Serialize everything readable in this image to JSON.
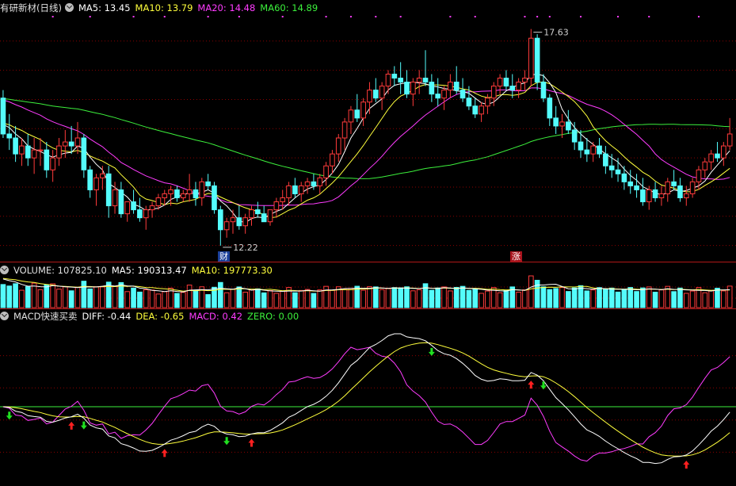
{
  "price_panel": {
    "title": "有研新材(日线)",
    "ma5_label": "MA5: 13.45",
    "ma10_label": "MA10: 13.79",
    "ma20_label": "MA20: 14.48",
    "ma60_label": "MA60: 14.89",
    "high_label": "17.63",
    "low_label": "12.22",
    "badge_cai": "财",
    "badge_zhang": "涨"
  },
  "volume_panel": {
    "volume_label": "VOLUME: 107825.10",
    "ma5_label": "MA5: 190313.47",
    "ma10_label": "MA10: 197773.30"
  },
  "macd_panel": {
    "title": "MACD快速买卖",
    "diff_label": "DIFF: -0.44",
    "dea_label": "DEA: -0.65",
    "macd_label": "MACD: 0.42",
    "zero_label": "ZERO: 0.00"
  },
  "colors": {
    "up": "#ff3b3b",
    "down": "#54fcfc",
    "ma5": "#ffffff",
    "ma10": "#ffff3c",
    "ma20": "#ff3cff",
    "ma60": "#3cf03c",
    "grid": "#8b0000",
    "separator": "#b01818"
  },
  "chart_data": {
    "type": "candlestick",
    "title": "有研新材(日线)",
    "ylim": [
      11.9,
      18.0
    ],
    "candles": [
      [
        15.9,
        16.1,
        14.9,
        15.0
      ],
      [
        15.0,
        15.5,
        14.6,
        14.9
      ],
      [
        14.9,
        15.2,
        14.3,
        14.5
      ],
      [
        14.5,
        14.9,
        14.2,
        14.7
      ],
      [
        14.7,
        15.0,
        14.2,
        14.4
      ],
      [
        14.4,
        14.9,
        14.0,
        14.6
      ],
      [
        14.6,
        14.9,
        14.2,
        14.6
      ],
      [
        14.6,
        14.8,
        13.9,
        14.1
      ],
      [
        14.1,
        14.6,
        13.8,
        14.4
      ],
      [
        14.4,
        14.9,
        14.2,
        14.7
      ],
      [
        14.7,
        15.1,
        14.4,
        14.8
      ],
      [
        14.8,
        15.2,
        14.5,
        14.7
      ],
      [
        14.7,
        15.3,
        14.5,
        14.9
      ],
      [
        14.9,
        15.0,
        13.9,
        14.1
      ],
      [
        14.1,
        14.2,
        13.4,
        13.6
      ],
      [
        13.6,
        14.0,
        13.2,
        13.9
      ],
      [
        13.9,
        14.2,
        13.6,
        14.0
      ],
      [
        14.0,
        14.2,
        12.9,
        13.2
      ],
      [
        13.2,
        13.8,
        13.0,
        13.6
      ],
      [
        13.6,
        13.8,
        12.9,
        13.0
      ],
      [
        13.0,
        13.3,
        12.8,
        13.3
      ],
      [
        13.3,
        13.6,
        13.0,
        13.1
      ],
      [
        13.1,
        13.4,
        12.8,
        12.9
      ],
      [
        12.9,
        13.2,
        12.6,
        13.1
      ],
      [
        13.1,
        13.3,
        12.9,
        13.2
      ],
      [
        13.2,
        13.5,
        13.1,
        13.4
      ],
      [
        13.4,
        13.6,
        13.2,
        13.5
      ],
      [
        13.5,
        13.7,
        13.2,
        13.6
      ],
      [
        13.6,
        13.7,
        13.3,
        13.4
      ],
      [
        13.4,
        13.6,
        13.3,
        13.5
      ],
      [
        13.5,
        14.0,
        13.3,
        13.6
      ],
      [
        13.6,
        13.8,
        13.2,
        13.4
      ],
      [
        13.4,
        13.9,
        13.2,
        13.8
      ],
      [
        13.8,
        14.0,
        13.6,
        13.7
      ],
      [
        13.7,
        13.8,
        13.0,
        13.1
      ],
      [
        13.1,
        13.2,
        12.2,
        12.6
      ],
      [
        12.6,
        12.9,
        12.4,
        12.8
      ],
      [
        12.8,
        13.1,
        12.5,
        12.9
      ],
      [
        12.9,
        13.2,
        12.6,
        12.7
      ],
      [
        12.7,
        13.0,
        12.5,
        12.9
      ],
      [
        12.9,
        13.2,
        12.7,
        13.1
      ],
      [
        13.1,
        13.3,
        12.9,
        13.0
      ],
      [
        13.0,
        13.2,
        12.8,
        12.8
      ],
      [
        12.8,
        13.1,
        12.7,
        13.1
      ],
      [
        13.1,
        13.4,
        12.9,
        13.3
      ],
      [
        13.3,
        13.6,
        13.1,
        13.4
      ],
      [
        13.4,
        13.8,
        13.2,
        13.7
      ],
      [
        13.7,
        13.9,
        13.4,
        13.5
      ],
      [
        13.5,
        13.8,
        13.3,
        13.7
      ],
      [
        13.7,
        13.9,
        13.5,
        13.8
      ],
      [
        13.8,
        14.0,
        13.6,
        13.7
      ],
      [
        13.7,
        14.0,
        13.5,
        13.9
      ],
      [
        13.9,
        14.3,
        13.7,
        14.2
      ],
      [
        14.2,
        14.6,
        14.0,
        14.5
      ],
      [
        14.5,
        15.0,
        14.3,
        14.9
      ],
      [
        14.9,
        15.4,
        14.6,
        15.3
      ],
      [
        15.3,
        15.7,
        15.0,
        15.6
      ],
      [
        15.6,
        16.0,
        15.3,
        15.4
      ],
      [
        15.4,
        15.9,
        15.2,
        15.8
      ],
      [
        15.8,
        16.3,
        15.5,
        16.1
      ],
      [
        16.1,
        16.4,
        15.8,
        15.9
      ],
      [
        15.9,
        16.3,
        15.6,
        16.2
      ],
      [
        16.2,
        16.6,
        16.0,
        16.5
      ],
      [
        16.5,
        16.7,
        16.2,
        16.4
      ],
      [
        16.4,
        16.8,
        16.0,
        16.3
      ],
      [
        16.3,
        16.6,
        15.9,
        16.0
      ],
      [
        16.0,
        16.4,
        15.7,
        16.3
      ],
      [
        16.3,
        16.6,
        16.0,
        16.4
      ],
      [
        16.4,
        17.1,
        16.2,
        16.3
      ],
      [
        16.3,
        16.5,
        15.8,
        16.0
      ],
      [
        16.0,
        16.4,
        15.7,
        15.9
      ],
      [
        15.9,
        16.2,
        15.6,
        16.1
      ],
      [
        16.1,
        16.5,
        15.9,
        16.3
      ],
      [
        16.3,
        16.7,
        16.0,
        16.1
      ],
      [
        16.1,
        16.4,
        15.8,
        15.9
      ],
      [
        15.9,
        16.2,
        15.6,
        15.7
      ],
      [
        15.7,
        15.9,
        15.4,
        15.5
      ],
      [
        15.5,
        15.8,
        15.3,
        15.7
      ],
      [
        15.7,
        16.0,
        15.5,
        15.9
      ],
      [
        15.9,
        16.3,
        15.7,
        16.2
      ],
      [
        16.2,
        16.5,
        16.0,
        16.4
      ],
      [
        16.4,
        16.6,
        16.1,
        16.2
      ],
      [
        16.2,
        16.5,
        15.9,
        16.1
      ],
      [
        16.1,
        16.4,
        15.9,
        16.3
      ],
      [
        16.3,
        16.6,
        16.1,
        16.4
      ],
      [
        16.4,
        17.63,
        16.2,
        17.4
      ],
      [
        17.4,
        17.5,
        16.1,
        16.3
      ],
      [
        16.3,
        16.5,
        15.8,
        15.9
      ],
      [
        15.9,
        16.0,
        15.2,
        15.4
      ],
      [
        15.4,
        15.7,
        15.0,
        15.2
      ],
      [
        15.2,
        15.5,
        14.9,
        15.3
      ],
      [
        15.3,
        15.6,
        15.0,
        15.1
      ],
      [
        15.1,
        15.3,
        14.6,
        14.8
      ],
      [
        14.8,
        15.1,
        14.4,
        14.6
      ],
      [
        14.6,
        14.9,
        14.3,
        14.5
      ],
      [
        14.5,
        14.8,
        14.3,
        14.7
      ],
      [
        14.7,
        14.9,
        14.4,
        14.5
      ],
      [
        14.5,
        14.7,
        14.0,
        14.2
      ],
      [
        14.2,
        14.5,
        13.9,
        14.1
      ],
      [
        14.1,
        14.4,
        13.8,
        14.0
      ],
      [
        14.0,
        14.2,
        13.6,
        13.8
      ],
      [
        13.8,
        14.1,
        13.5,
        13.7
      ],
      [
        13.7,
        14.0,
        13.4,
        13.6
      ],
      [
        13.6,
        13.9,
        13.2,
        13.3
      ],
      [
        13.3,
        13.7,
        13.1,
        13.6
      ],
      [
        13.6,
        13.8,
        13.3,
        13.4
      ],
      [
        13.4,
        13.7,
        13.2,
        13.5
      ],
      [
        13.5,
        13.9,
        13.3,
        13.8
      ],
      [
        13.8,
        14.1,
        13.6,
        13.7
      ],
      [
        13.7,
        13.9,
        13.3,
        13.4
      ],
      [
        13.4,
        13.7,
        13.2,
        13.5
      ],
      [
        13.5,
        13.9,
        13.4,
        13.8
      ],
      [
        13.8,
        14.2,
        13.6,
        14.1
      ],
      [
        14.1,
        14.4,
        13.9,
        14.3
      ],
      [
        14.3,
        14.6,
        14.1,
        14.5
      ],
      [
        14.5,
        14.8,
        14.3,
        14.4
      ],
      [
        14.4,
        14.8,
        14.2,
        14.7
      ],
      [
        14.7,
        15.4,
        14.6,
        15.0
      ]
    ]
  }
}
